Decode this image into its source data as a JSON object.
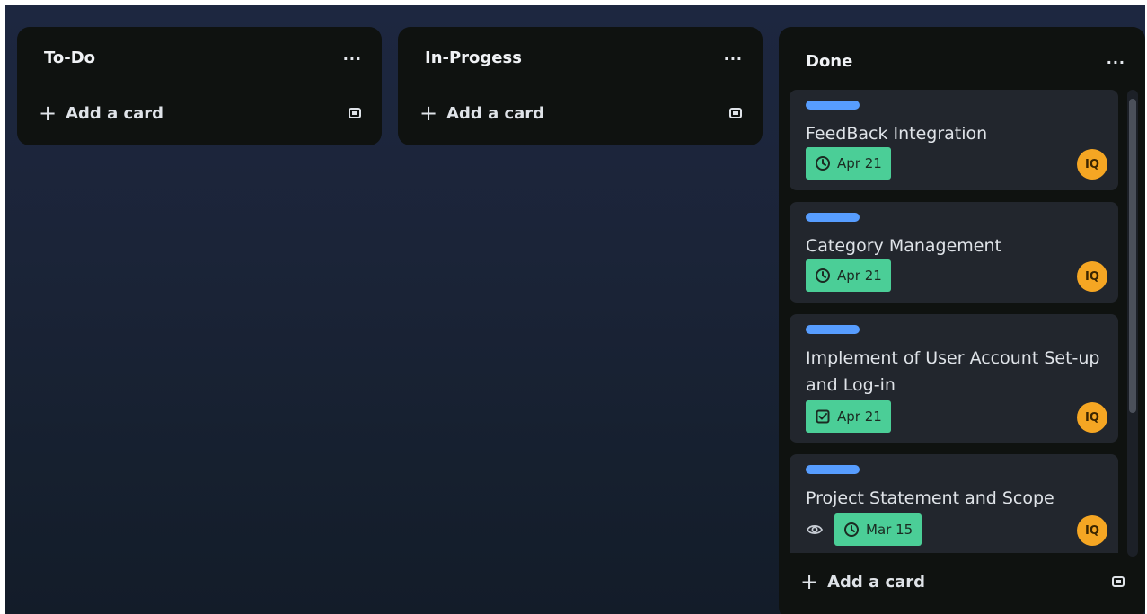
{
  "lists": [
    {
      "title": "To-Do",
      "menu": "...",
      "add_card": "Add a card"
    },
    {
      "title": "In-Progess",
      "menu": "...",
      "add_card": "Add a card"
    },
    {
      "title": "Done",
      "menu": "...",
      "add_card": "Add a card",
      "cards": [
        {
          "title": "FeedBack Integration",
          "badge_icon": "clock-icon",
          "date": "Apr 21",
          "member": "IQ",
          "label_color": "#579dff"
        },
        {
          "title": "Category Management",
          "badge_icon": "clock-icon",
          "date": "Apr 21",
          "member": "IQ",
          "label_color": "#579dff"
        },
        {
          "title": "Implement of User Account Set-up and Log-in",
          "badge_icon": "checkbox-icon",
          "date": "Apr 21",
          "member": "IQ",
          "label_color": "#579dff"
        },
        {
          "title": "Project Statement and Scope",
          "badge_icon": "clock-icon",
          "watch_icon": "eye-icon",
          "date": "Mar 15",
          "member": "IQ",
          "label_color": "#579dff"
        }
      ]
    }
  ],
  "colors": {
    "list_bg": "#0f1210",
    "card_bg": "#22262d",
    "date_badge": "#4bce97",
    "avatar": "#f5a623",
    "label": "#579dff"
  }
}
